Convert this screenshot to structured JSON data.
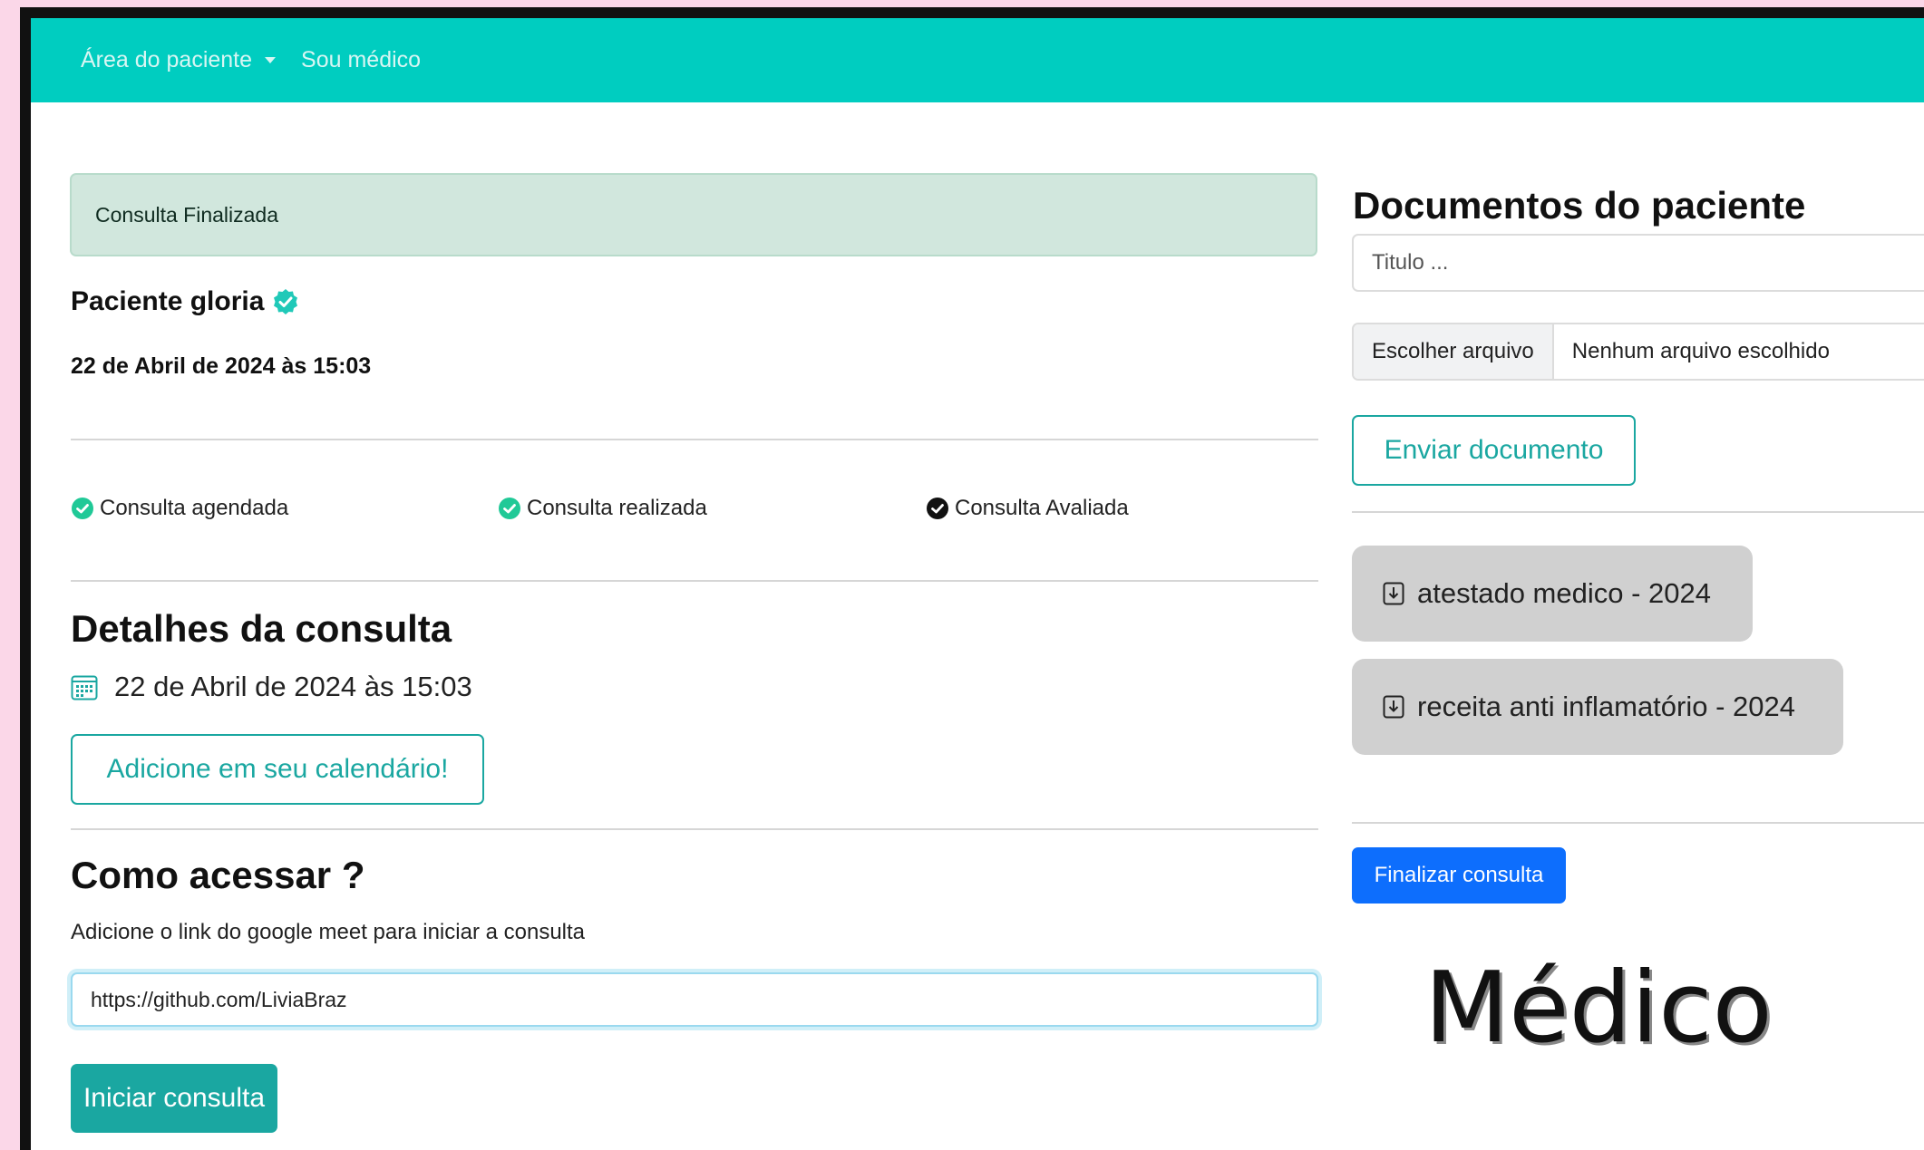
{
  "nav": {
    "patient_area": "Área do paciente",
    "doctor": "Sou médico"
  },
  "alert": {
    "text": "Consulta Finalizada"
  },
  "patient": {
    "name": "Paciente gloria",
    "datetime": "22 de Abril de 2024 às 15:03"
  },
  "steps": [
    {
      "label": "Consulta agendada",
      "state": "done",
      "color": "#20c997"
    },
    {
      "label": "Consulta realizada",
      "state": "done",
      "color": "#20c997"
    },
    {
      "label": "Consulta Avaliada",
      "state": "done",
      "color": "#111111"
    }
  ],
  "details": {
    "heading": "Detalhes da consulta",
    "datetime": "22 de Abril de 2024 às 15:03",
    "calendar_button": "Adicione em seu calendário!"
  },
  "access": {
    "heading": "Como acessar ?",
    "help_text": "Adicione o link do google meet para iniciar a consulta",
    "link_value": "https://github.com/LiviaBraz",
    "start_button": "Iniciar consulta"
  },
  "documents": {
    "heading": "Documentos do paciente",
    "title_placeholder": "Titulo ...",
    "choose_file": "Escolher arquivo",
    "no_file": "Nenhum arquivo escolhido",
    "send_button": "Enviar documento",
    "files": [
      {
        "label": "atestado medico - 2024"
      },
      {
        "label": "receita anti inflamatório - 2024"
      }
    ],
    "finish_button": "Finalizar consulta"
  },
  "overlay_label": "Médico",
  "colors": {
    "navbar": "#00cdc0",
    "teal": "#1aa7a1",
    "primary": "#0d6efd",
    "alert_bg": "#d1e7dd",
    "page_border": "#fbd7e8"
  }
}
